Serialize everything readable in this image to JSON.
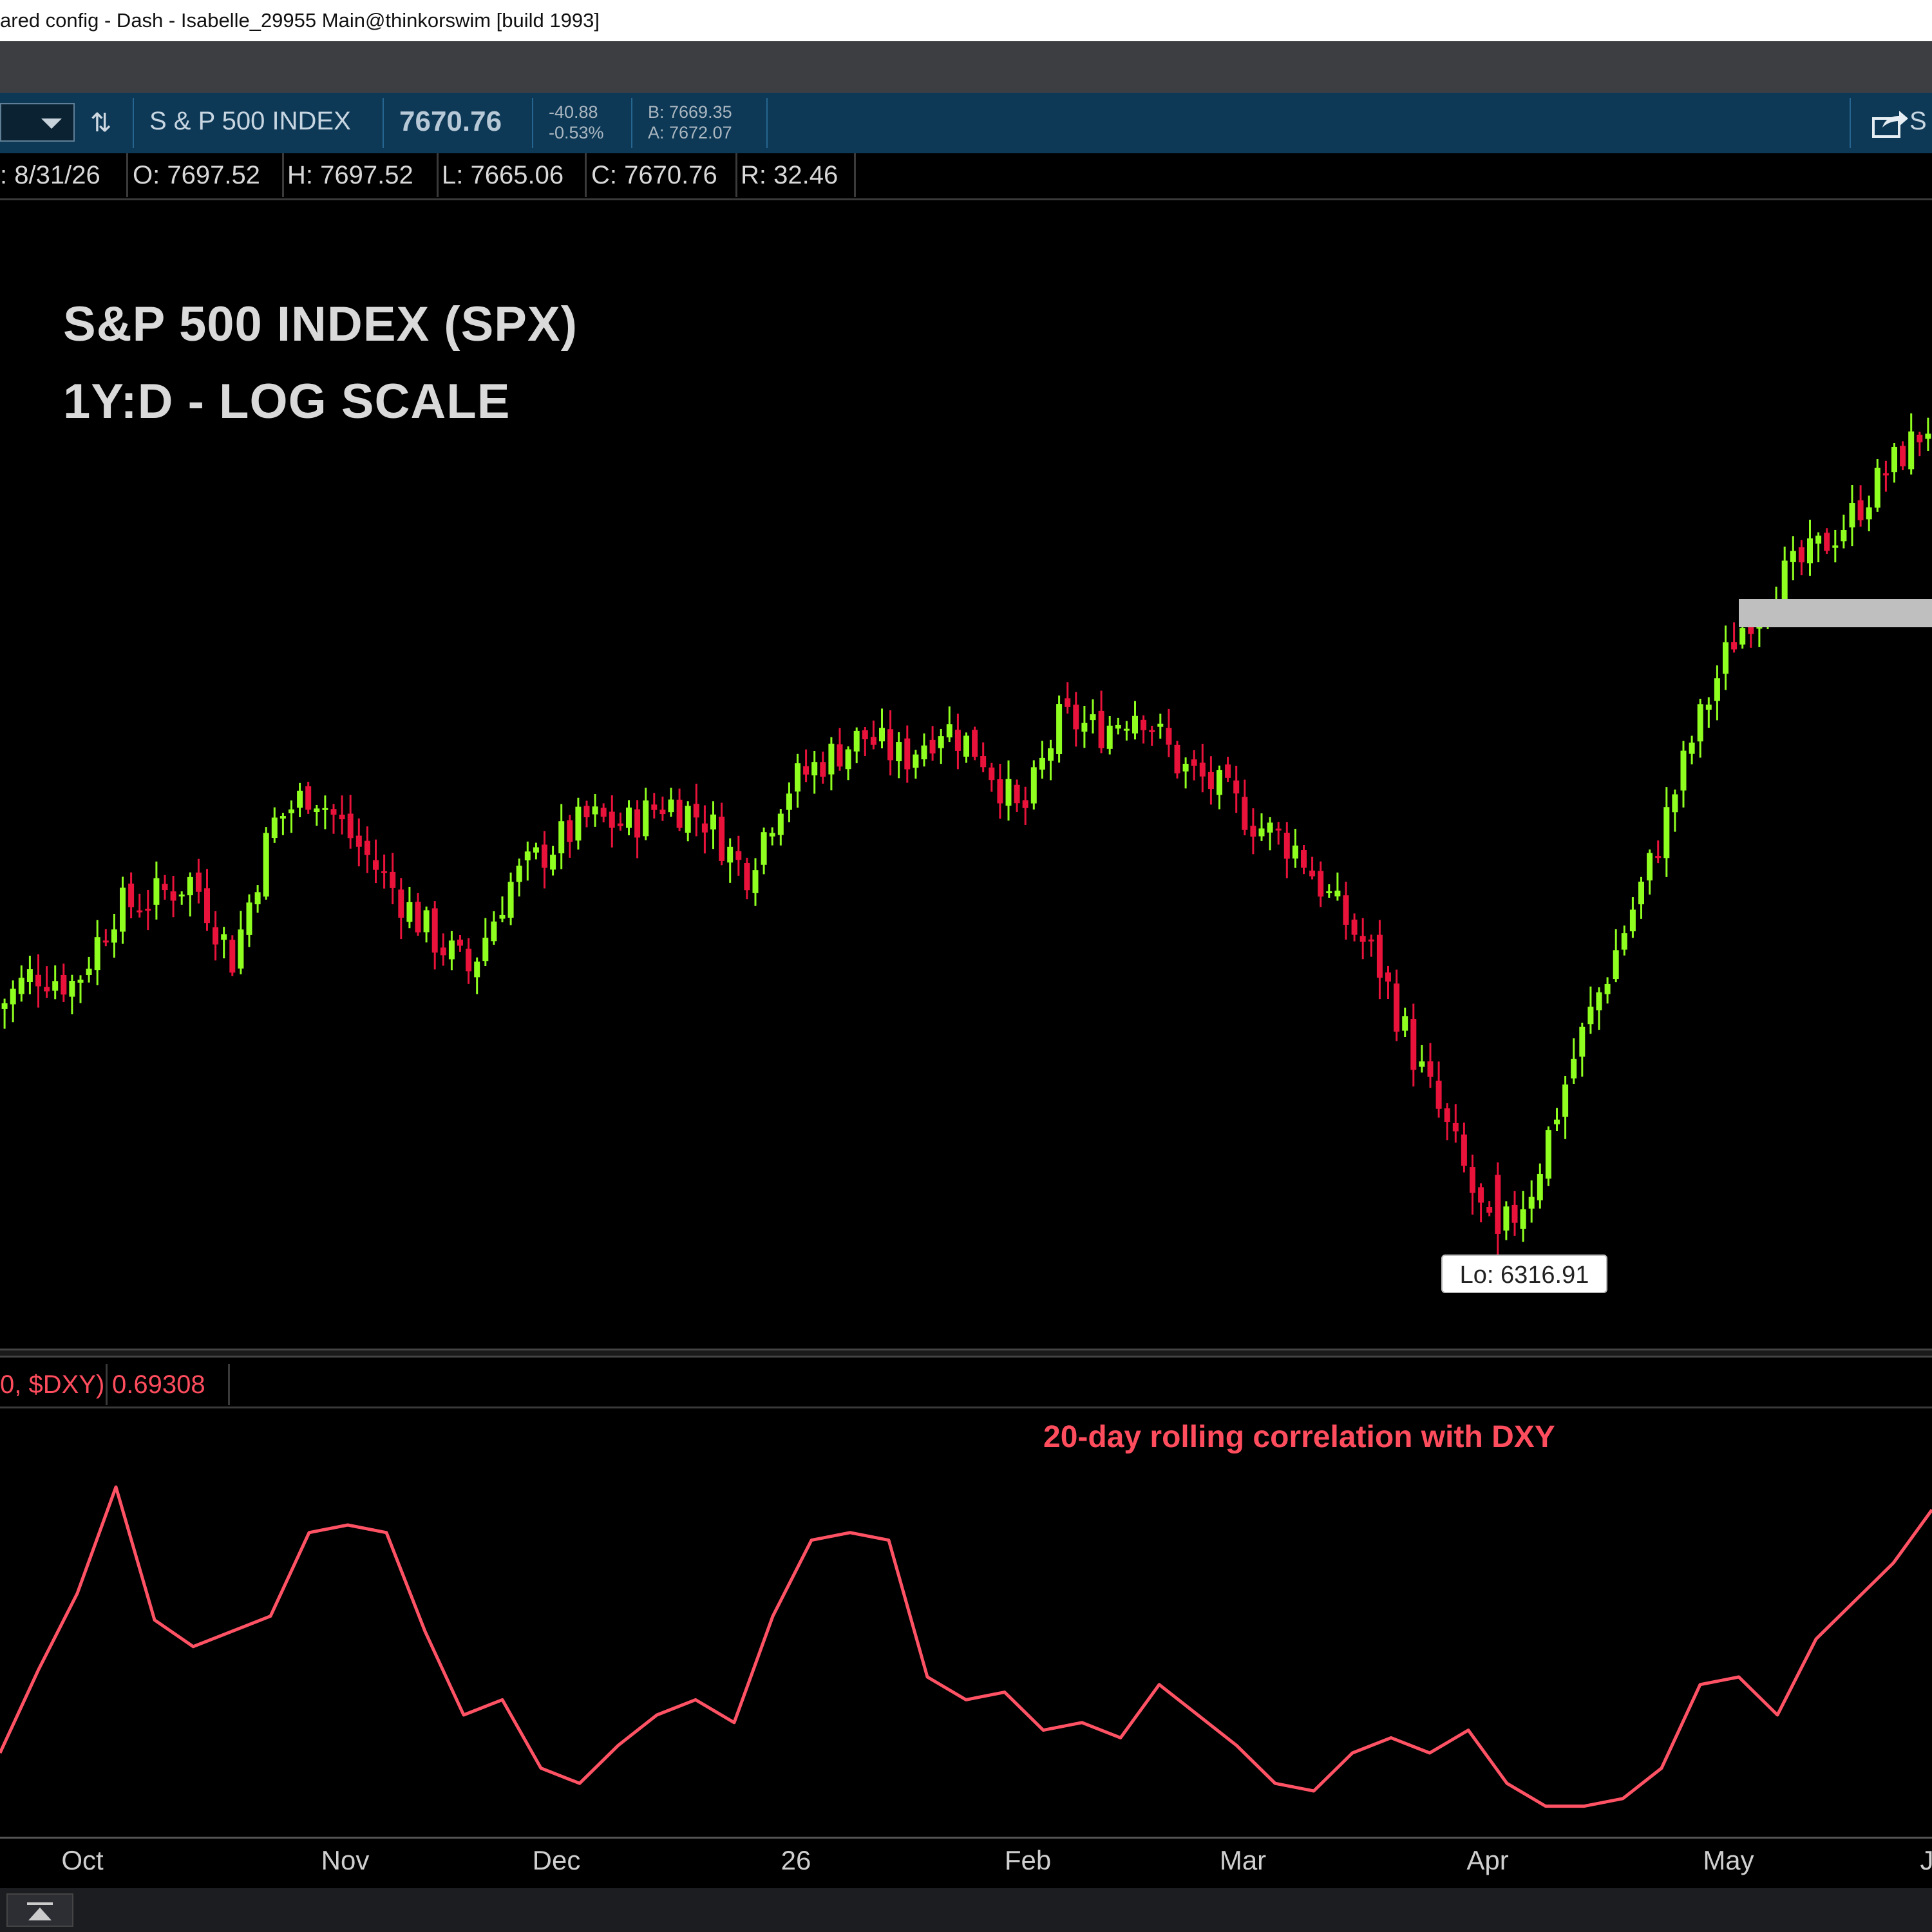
{
  "window": {
    "title": "ared config - Dash - Isabelle_29955 Main@thinkorswim [build 1993]"
  },
  "quote": {
    "symbol_dropdown": "",
    "name": "S & P 500 INDEX",
    "last": "7670.76",
    "change": "-40.88",
    "change_pct": "-0.53%",
    "bid": "B: 7669.35",
    "ask": "A: 7672.07",
    "share_label": "S"
  },
  "ohlc": {
    "date": ": 8/31/26",
    "open": "O: 7697.52",
    "high": "H: 7697.52",
    "low": "L: 7665.06",
    "close": "C: 7670.76",
    "range": "R: 32.46"
  },
  "chart": {
    "title_line1": "S&P 500 INDEX (SPX)",
    "title_line2": "1Y:D - LOG SCALE",
    "low_bubble": "Lo: 6316.91",
    "colors": {
      "up": "#8fff1f",
      "down": "#e8123a",
      "corr_line": "#ff5264",
      "highlight_band": "#bfbfbf"
    }
  },
  "study": {
    "name": "0, $DXY)",
    "value": "0.69308",
    "label": "20-day rolling correlation with DXY"
  },
  "xaxis": {
    "ticks": [
      "Oct",
      "Nov",
      "Dec",
      "26",
      "Feb",
      "Mar",
      "Apr",
      "May",
      "J"
    ]
  },
  "chart_data": [
    {
      "type": "candlestick",
      "title": "S&P 500 INDEX (SPX)",
      "subtitle": "1Y:D - LOG SCALE",
      "scale": "log",
      "x_labels": [
        "Oct",
        "Nov",
        "Dec",
        "26",
        "Feb",
        "Mar",
        "Apr",
        "May",
        "J"
      ],
      "annotations": [
        {
          "text": "Lo: 6316.91",
          "value": 6316.91
        }
      ],
      "price_path": [
        6700,
        6760,
        6740,
        6860,
        6880,
        6910,
        6780,
        7000,
        7060,
        6980,
        6900,
        6820,
        6760,
        6900,
        6960,
        7010,
        7000,
        7040,
        7010,
        6920,
        7060,
        7110,
        7150,
        7110,
        7170,
        7120,
        7010,
        7180,
        7160,
        7200,
        7100,
        7060,
        7000,
        6960,
        6860,
        6780,
        6620,
        6480,
        6330,
        6430,
        6620,
        6780,
        6940,
        7140,
        7310,
        7410,
        7460,
        7530,
        7620,
        7700
      ]
    },
    {
      "type": "line",
      "series": [
        {
          "name": "20-day rolling correlation with DXY"
        }
      ],
      "current_value": 0.69308,
      "values": [
        0.2,
        0.42,
        0.62,
        0.9,
        0.55,
        0.48,
        0.52,
        0.56,
        0.78,
        0.8,
        0.78,
        0.52,
        0.3,
        0.34,
        0.16,
        0.12,
        0.22,
        0.3,
        0.34,
        0.28,
        0.56,
        0.76,
        0.78,
        0.76,
        0.4,
        0.34,
        0.36,
        0.26,
        0.28,
        0.24,
        0.38,
        0.3,
        0.22,
        0.12,
        0.1,
        0.2,
        0.24,
        0.2,
        0.26,
        0.12,
        0.06,
        0.06,
        0.08,
        0.16,
        0.38,
        0.4,
        0.3,
        0.5,
        0.6,
        0.7,
        0.84
      ]
    }
  ]
}
